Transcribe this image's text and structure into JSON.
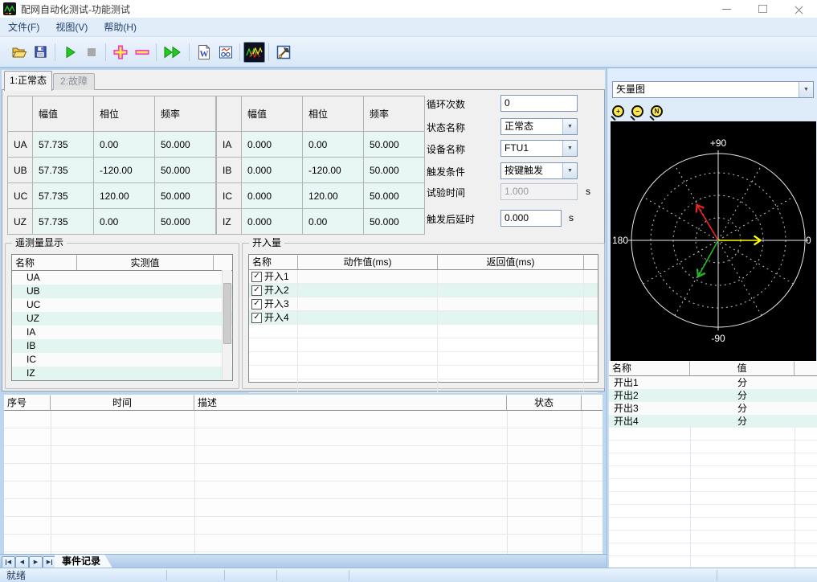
{
  "window": {
    "title": "配网自动化测试-功能测试"
  },
  "menu": {
    "items": [
      {
        "label": "文件(F)"
      },
      {
        "label": "视图(V)"
      },
      {
        "label": "帮助(H)"
      }
    ]
  },
  "toolbar": {
    "buttons": [
      {
        "name": "open"
      },
      {
        "name": "save"
      },
      {
        "name": "start"
      },
      {
        "name": "stop"
      },
      {
        "name": "add"
      },
      {
        "name": "remove"
      },
      {
        "name": "run-all"
      },
      {
        "name": "word-report"
      },
      {
        "name": "report-view"
      },
      {
        "name": "waveform"
      },
      {
        "name": "tools"
      }
    ]
  },
  "tabs": [
    {
      "label": "1:正常态",
      "active": true
    },
    {
      "label": "2:故障",
      "active": false
    }
  ],
  "signal_headers": {
    "amp": "幅值",
    "phase": "相位",
    "freq": "频率"
  },
  "voltage_rows": [
    {
      "name": "UA",
      "amp": "57.735",
      "phase": "0.00",
      "freq": "50.000"
    },
    {
      "name": "UB",
      "amp": "57.735",
      "phase": "-120.00",
      "freq": "50.000"
    },
    {
      "name": "UC",
      "amp": "57.735",
      "phase": "120.00",
      "freq": "50.000"
    },
    {
      "name": "UZ",
      "amp": "57.735",
      "phase": "0.00",
      "freq": "50.000"
    }
  ],
  "current_rows": [
    {
      "name": "IA",
      "amp": "0.000",
      "phase": "0.00",
      "freq": "50.000"
    },
    {
      "name": "IB",
      "amp": "0.000",
      "phase": "-120.00",
      "freq": "50.000"
    },
    {
      "name": "IC",
      "amp": "0.000",
      "phase": "120.00",
      "freq": "50.000"
    },
    {
      "name": "IZ",
      "amp": "0.000",
      "phase": "0.00",
      "freq": "50.000"
    }
  ],
  "controls": {
    "cycle_count": {
      "label": "循环次数",
      "value": "0"
    },
    "state_name": {
      "label": "状态名称",
      "value": "正常态"
    },
    "device_name": {
      "label": "设备名称",
      "value": "FTU1"
    },
    "trigger_condition": {
      "label": "触发条件",
      "value": "按键触发"
    },
    "test_time": {
      "label": "试验时间",
      "value": "1.000",
      "unit": "s"
    },
    "trigger_delay": {
      "label": "触发后延时",
      "value": "0.000",
      "unit": "s"
    }
  },
  "telemetry": {
    "title": "遥测量显示",
    "col_name": "名称",
    "col_value": "实测值",
    "rows": [
      {
        "name": "UA",
        "value": ""
      },
      {
        "name": "UB",
        "value": ""
      },
      {
        "name": "UC",
        "value": ""
      },
      {
        "name": "UZ",
        "value": ""
      },
      {
        "name": "IA",
        "value": ""
      },
      {
        "name": "IB",
        "value": ""
      },
      {
        "name": "IC",
        "value": ""
      },
      {
        "name": "IZ",
        "value": ""
      }
    ]
  },
  "digital_inputs": {
    "title": "开入量",
    "col_name": "名称",
    "col_action": "动作值(ms)",
    "col_return": "返回值(ms)",
    "rows": [
      {
        "label": "开入1",
        "checked": true,
        "action": "",
        "return": ""
      },
      {
        "label": "开入2",
        "checked": true,
        "action": "",
        "return": ""
      },
      {
        "label": "开入3",
        "checked": true,
        "action": "",
        "return": ""
      },
      {
        "label": "开入4",
        "checked": true,
        "action": "",
        "return": ""
      }
    ]
  },
  "event_table": {
    "col_no": "序号",
    "col_time": "时间",
    "col_desc": "描述",
    "col_status": "状态",
    "rows": []
  },
  "event_tab": {
    "label": "事件记录"
  },
  "status_bar": {
    "text": "就绪"
  },
  "vector_panel": {
    "selector_value": "矢量图",
    "zoom_tools": [
      {
        "name": "zoom-in",
        "glyph": "+"
      },
      {
        "name": "zoom-out",
        "glyph": "−"
      },
      {
        "name": "zoom-reset",
        "glyph": "N"
      }
    ],
    "plot": {
      "type": "polar-vector",
      "label_top": "+90",
      "label_bottom": "-90",
      "label_left": "180",
      "label_right": "0",
      "vectors": [
        {
          "name": "UA",
          "color": "#ffff00",
          "angle_deg": 0,
          "magnitude": 0.48
        },
        {
          "name": "UC",
          "color": "#ee2222",
          "angle_deg": 121,
          "magnitude": 0.47
        },
        {
          "name": "UB",
          "color": "#22bb22",
          "angle_deg": -119,
          "magnitude": 0.47
        }
      ]
    },
    "output_table": {
      "col_name": "名称",
      "col_value": "值",
      "rows": [
        {
          "name": "开出1",
          "value": "分"
        },
        {
          "name": "开出2",
          "value": "分"
        },
        {
          "name": "开出3",
          "value": "分"
        },
        {
          "name": "开出4",
          "value": "分"
        }
      ]
    }
  }
}
